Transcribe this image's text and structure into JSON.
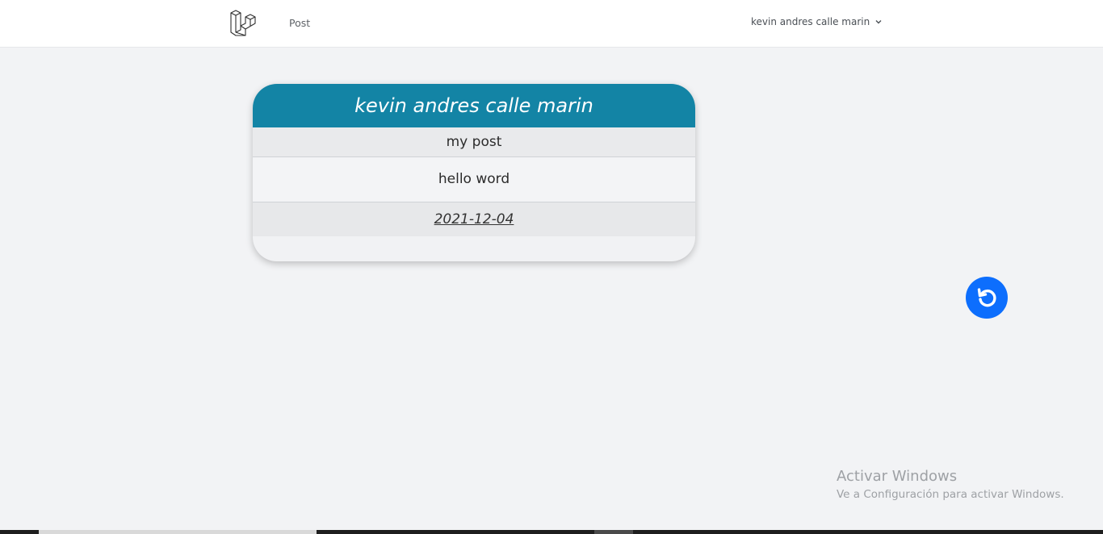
{
  "nav": {
    "logo_icon": "laravel-logo-icon",
    "links": [
      "Post"
    ],
    "user_name": "kevin andres calle marin",
    "user_menu_icon": "chevron-down-icon"
  },
  "post": {
    "author": "kevin andres calle marin",
    "title": "my post",
    "body": "hello word",
    "date": "2021-12-04"
  },
  "back_button": {
    "icon": "undo-arrow-icon",
    "color": "#0d6efd"
  },
  "watermark": {
    "title": "Activar Windows",
    "subtitle": "Ve a Configuración para activar Windows."
  },
  "colors": {
    "card_header": "#1384a5",
    "background": "#f2f3f5"
  }
}
